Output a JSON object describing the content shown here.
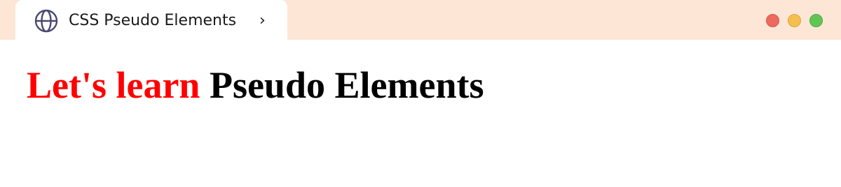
{
  "tab": {
    "icon": "globe-icon",
    "title": "CSS Pseudo Elements",
    "chevron_icon": "chevron-right-icon",
    "chevron_glyph": "›"
  },
  "window_controls": {
    "close_color": "#ed6a5e",
    "minimize_color": "#f5bf4f",
    "maximize_color": "#61c554"
  },
  "content": {
    "heading_lead": "Let's learn",
    "heading_rest": " Pseudo Elements",
    "heading_lead_color": "#ff0000"
  },
  "colors": {
    "titlebar": "#fde6d6",
    "tab": "#ffffff"
  }
}
